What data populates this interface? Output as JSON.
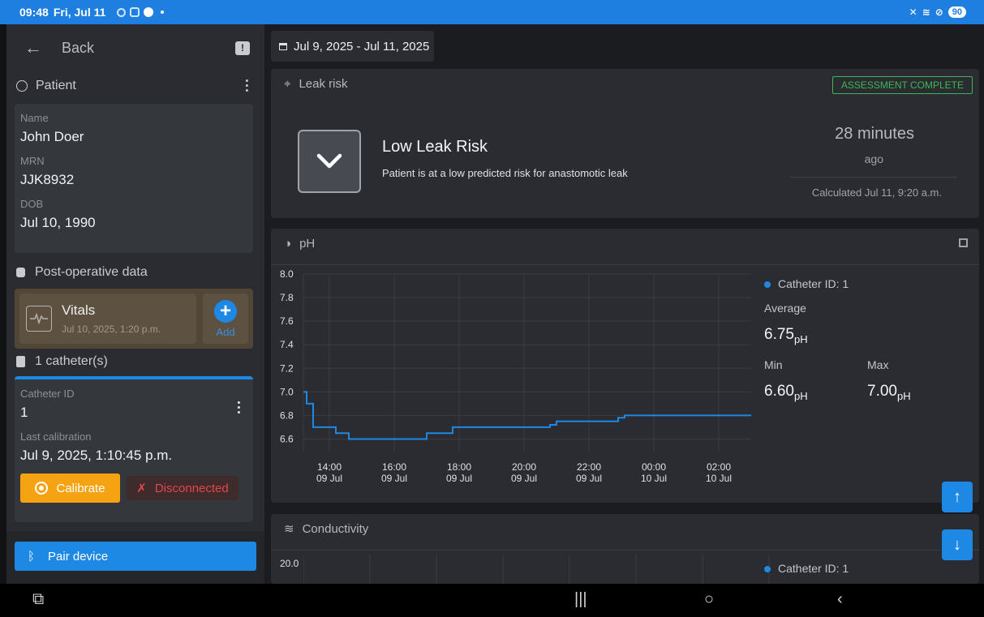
{
  "status_bar": {
    "time": "09:48",
    "date": "Fri, Jul 11",
    "battery": "90"
  },
  "sidebar": {
    "back_label": "Back",
    "patient_section": "Patient",
    "name_label": "Name",
    "name_value": "John Doer",
    "mrn_label": "MRN",
    "mrn_value": "JJK8932",
    "dob_label": "DOB",
    "dob_value": "Jul 10, 1990",
    "post_op_section": "Post-operative data",
    "vitals_title": "Vitals",
    "vitals_date": "Jul 10, 2025, 1:20 p.m.",
    "add_label": "Add",
    "catheters_section": "1 catheter(s)",
    "catheter_id_label": "Catheter ID",
    "catheter_id_value": "1",
    "last_calibration_label": "Last calibration",
    "last_calibration_value": "Jul 9, 2025, 1:10:45 p.m.",
    "calibrate_label": "Calibrate",
    "disconnected_label": "Disconnected",
    "pair_device_label": "Pair device"
  },
  "main": {
    "date_range": "Jul 9, 2025 - Jul 11, 2025",
    "leak_panel": {
      "title": "Leak risk",
      "badge": "ASSESSMENT COMPLETE",
      "risk_title": "Low Leak Risk",
      "risk_desc": "Patient is at a low predicted risk for anastomotic leak",
      "time_value": "28 minutes",
      "time_suffix": "ago",
      "calculated": "Calculated Jul 11, 9:20 a.m."
    },
    "ph_panel": {
      "title": "pH",
      "legend": "Catheter ID: 1",
      "average_label": "Average",
      "average_value": "6.75",
      "unit": "pH",
      "min_label": "Min",
      "min_value": "6.60",
      "max_label": "Max",
      "max_value": "7.00"
    },
    "conductivity_panel": {
      "title": "Conductivity",
      "legend": "Catheter ID: 1",
      "y_top": "20.0"
    }
  },
  "chart_data": {
    "type": "line",
    "title": "pH",
    "y_ticks": [
      "8.0",
      "7.8",
      "7.6",
      "7.4",
      "7.2",
      "7.0",
      "6.8",
      "6.6"
    ],
    "x_ticks": [
      {
        "time": "14:00",
        "date": "09 Jul"
      },
      {
        "time": "16:00",
        "date": "09 Jul"
      },
      {
        "time": "18:00",
        "date": "09 Jul"
      },
      {
        "time": "20:00",
        "date": "09 Jul"
      },
      {
        "time": "22:00",
        "date": "09 Jul"
      },
      {
        "time": "00:00",
        "date": "10 Jul"
      },
      {
        "time": "02:00",
        "date": "10 Jul"
      }
    ],
    "ylim": [
      6.5,
      8.0
    ],
    "x_range_hours": [
      13.2,
      27.0
    ],
    "series": [
      {
        "name": "Catheter ID: 1",
        "color": "#1e88e5",
        "points": [
          [
            13.2,
            7.0
          ],
          [
            13.3,
            6.9
          ],
          [
            13.5,
            6.7
          ],
          [
            14.2,
            6.65
          ],
          [
            14.6,
            6.6
          ],
          [
            17.0,
            6.6
          ],
          [
            17.0,
            6.65
          ],
          [
            17.8,
            6.7
          ],
          [
            20.8,
            6.72
          ],
          [
            21.0,
            6.75
          ],
          [
            22.9,
            6.78
          ],
          [
            23.1,
            6.8
          ],
          [
            27.0,
            6.8
          ]
        ]
      }
    ]
  }
}
